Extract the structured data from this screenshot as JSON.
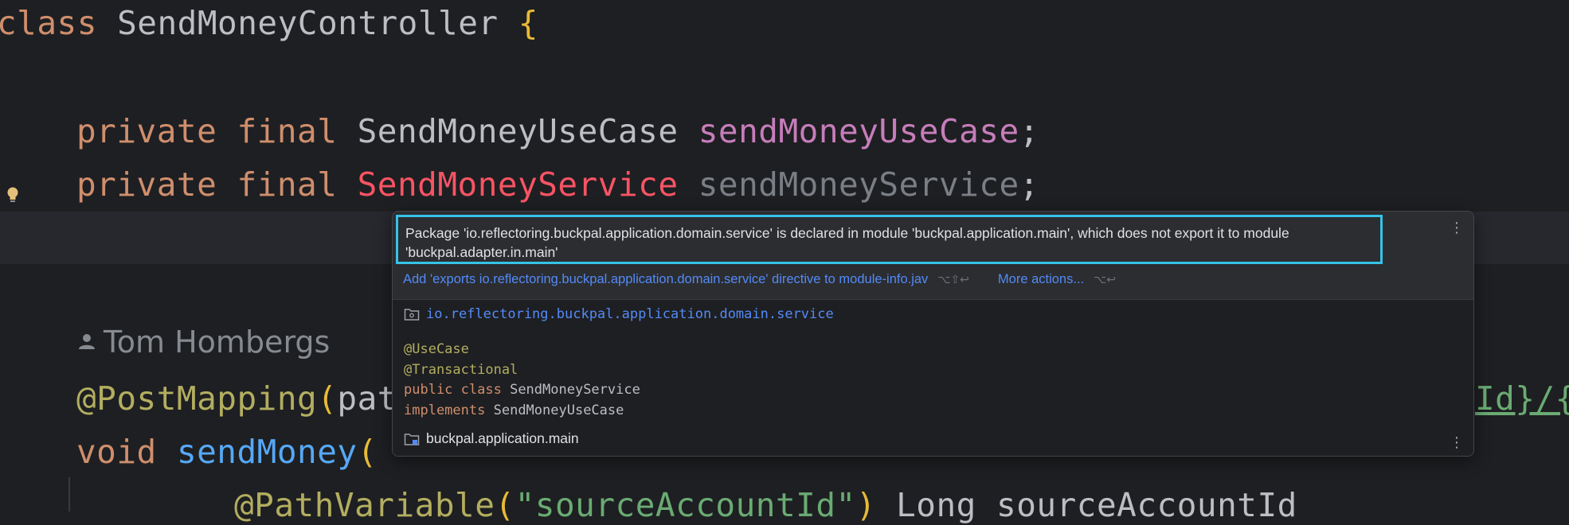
{
  "code": {
    "line1": {
      "kw": "class",
      "name": "SendMoneyController",
      "brace": "{"
    },
    "line2": {
      "kw": "private final",
      "type": "SendMoneyUseCase",
      "field": "sendMoneyUseCase",
      "semi": ";"
    },
    "line3": {
      "kw": "private final",
      "type": "SendMoneyService",
      "field": "sendMoneyService",
      "semi": ";"
    },
    "author": "Tom Hombergs",
    "line5": {
      "ann": "@PostMapping",
      "paren": "(",
      "text": "path",
      "right_fragment": "Id}/{"
    },
    "line6": {
      "kw": "void",
      "method": "sendMoney",
      "paren": "("
    },
    "line7": {
      "ann": "@PathVariable",
      "paren_open": "(",
      "str": "\"sourceAccountId\"",
      "paren_close": ")",
      "type": "Long",
      "param": "sourceAccountId"
    }
  },
  "popup": {
    "message": "Package 'io.reflectoring.buckpal.application.domain.service' is declared in module 'buckpal.application.main', which does not export it to module 'buckpal.adapter.in.main'",
    "fix_action": "Add 'exports io.reflectoring.buckpal.application.domain.service' directive to module-info.jav",
    "fix_shortcut": "⌥⇧↩",
    "more_actions": "More actions...",
    "more_shortcut": "⌥↩",
    "menu_glyph": "⋮",
    "package_name": "io.reflectoring.buckpal.application.domain.service",
    "doc": {
      "ann1": "@UseCase",
      "ann2": "@Transactional",
      "decl_kw": "public class",
      "decl_name": "SendMoneyService",
      "impl_kw": "implements",
      "impl_name": "SendMoneyUseCase"
    },
    "module_name": "buckpal.application.main"
  },
  "icons": [
    "lightbulb-icon",
    "person-icon",
    "package-icon",
    "module-icon",
    "more-options-icon"
  ],
  "colors": {
    "background": "#1e1f22",
    "keyword": "#cf8e6d",
    "field": "#c77dbb",
    "error": "#f75464",
    "link": "#548af7",
    "highlight_border": "#35c3e8"
  }
}
